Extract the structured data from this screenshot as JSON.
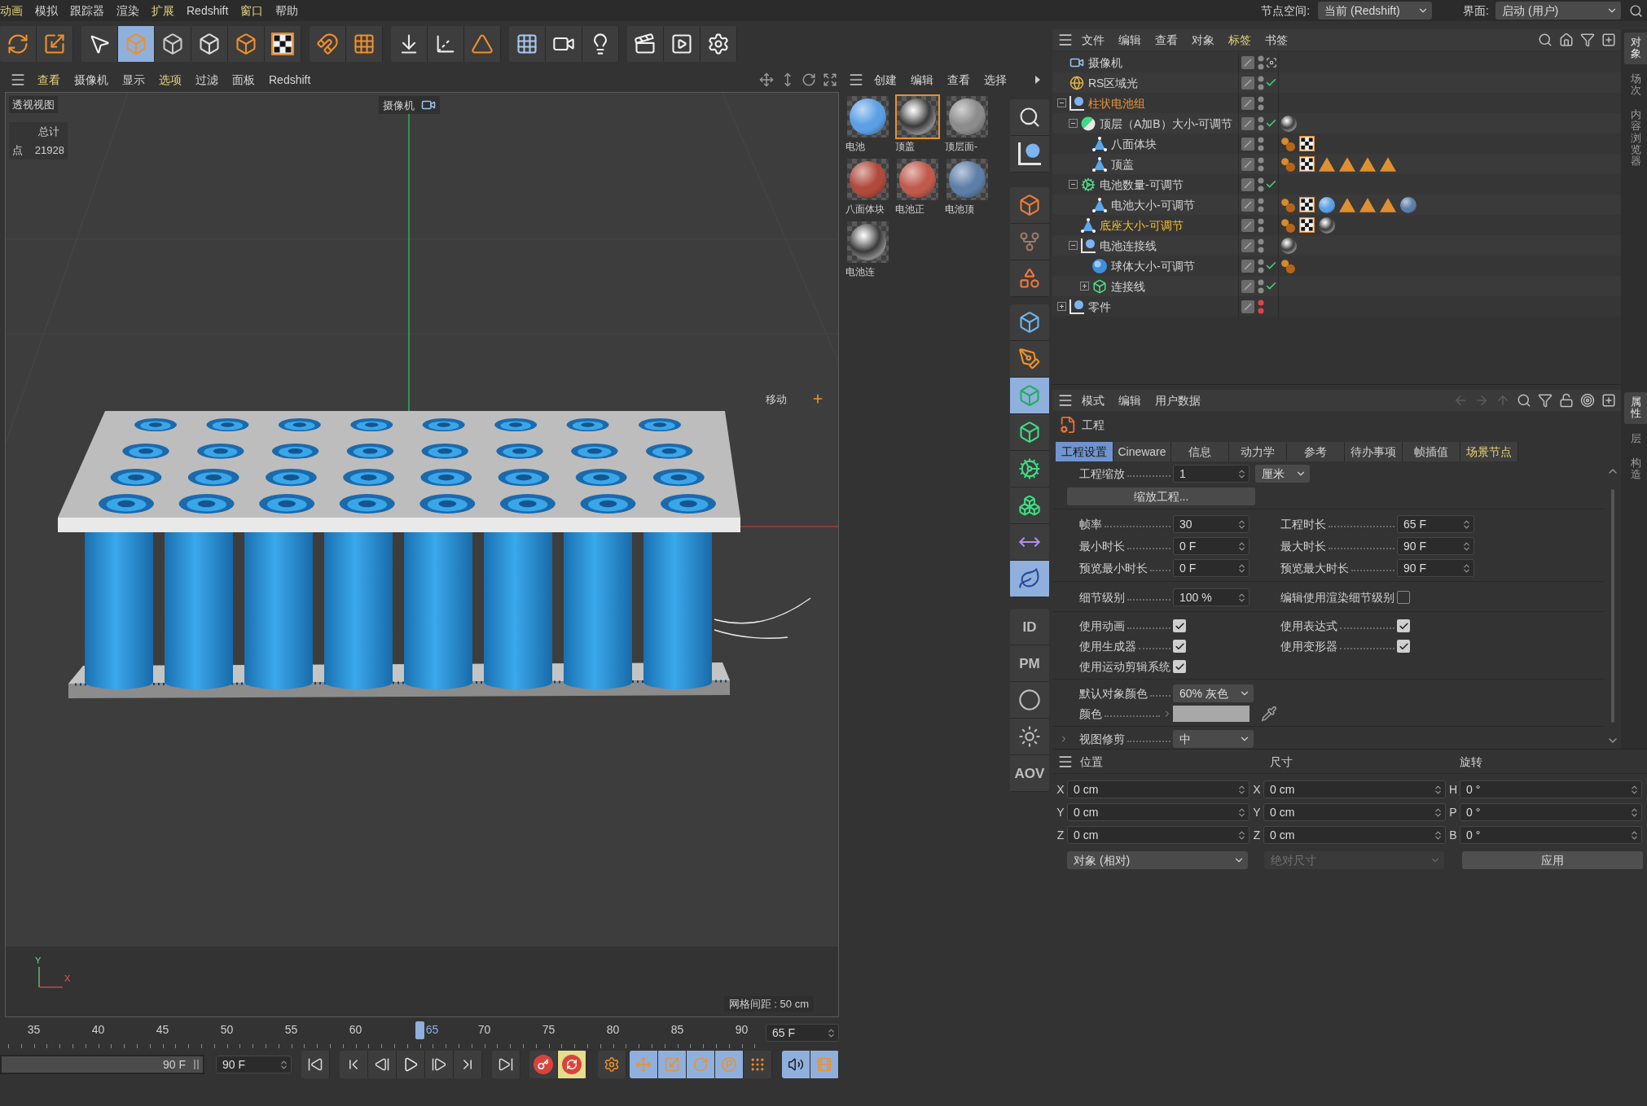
{
  "menu_bar": {
    "items": [
      {
        "label": "动画",
        "accent": true
      },
      {
        "label": "模拟",
        "accent": false
      },
      {
        "label": "跟踪器",
        "accent": false
      },
      {
        "label": "渲染",
        "accent": false
      },
      {
        "label": "扩展",
        "accent": true
      },
      {
        "label": "Redshift",
        "accent": false
      },
      {
        "label": "窗口",
        "accent": true
      },
      {
        "label": "帮助",
        "accent": false
      }
    ],
    "node_space": {
      "label": "节点空间:",
      "value": "当前 (Redshift)"
    },
    "interface": {
      "label": "界面:",
      "value": "启动 (用户)"
    }
  },
  "toolbar": [
    [
      {
        "kind": "undo",
        "selected": false
      },
      {
        "kind": "scale",
        "selected": false
      }
    ],
    [
      {
        "kind": "select",
        "selected": false
      },
      {
        "kind": "model",
        "selected": true
      },
      {
        "kind": "points",
        "selected": false
      },
      {
        "kind": "edges",
        "selected": false
      },
      {
        "kind": "polygons",
        "selected": false
      },
      {
        "kind": "uv",
        "selected": false
      }
    ],
    [
      {
        "kind": "magnet",
        "selected": false
      },
      {
        "kind": "grid",
        "selected": false
      }
    ],
    [
      {
        "kind": "floor-snap",
        "selected": false
      },
      {
        "kind": "axis",
        "selected": false
      },
      {
        "kind": "triangle",
        "selected": false
      }
    ],
    [
      {
        "kind": "floor",
        "selected": false
      },
      {
        "kind": "camera",
        "selected": false
      },
      {
        "kind": "light",
        "selected": false
      }
    ],
    [
      {
        "kind": "render-region",
        "selected": false
      },
      {
        "kind": "render",
        "selected": false
      },
      {
        "kind": "render-settings",
        "selected": false
      }
    ]
  ],
  "viewport": {
    "menu": [
      {
        "label": "查看",
        "accent": true
      },
      {
        "label": "摄像机",
        "accent": false
      },
      {
        "label": "显示",
        "accent": false
      },
      {
        "label": "选项",
        "accent": true
      },
      {
        "label": "过滤",
        "accent": false
      },
      {
        "label": "面板",
        "accent": false
      },
      {
        "label": "Redshift",
        "accent": false
      }
    ],
    "title": "透视视图",
    "camera": "摄像机",
    "hud": {
      "header": "总计",
      "rows": [
        {
          "label": "点",
          "value": "21928"
        }
      ]
    },
    "tool": "移动",
    "grid_spacing": "网格间距 : 50 cm",
    "axes": {
      "y": "Y",
      "x": "X"
    }
  },
  "timeline": {
    "ticks": [
      {
        "label": "35",
        "current": false
      },
      {
        "label": "40",
        "current": false
      },
      {
        "label": "45",
        "current": false
      },
      {
        "label": "50",
        "current": false
      },
      {
        "label": "55",
        "current": false
      },
      {
        "label": "60",
        "current": false
      },
      {
        "label": "65",
        "current": true
      },
      {
        "label": "70",
        "current": false
      },
      {
        "label": "75",
        "current": false
      },
      {
        "label": "80",
        "current": false
      },
      {
        "label": "85",
        "current": false
      },
      {
        "label": "90",
        "current": false
      }
    ],
    "current_frame": "65 F"
  },
  "transport": {
    "range": {
      "end": "90 F",
      "level": 1
    },
    "max_frame": "90 F",
    "groups": [
      [
        {
          "kind": "start",
          "selected": false
        }
      ],
      [
        {
          "kind": "prev-key",
          "selected": false
        },
        {
          "kind": "prev-frame",
          "selected": false
        },
        {
          "kind": "play",
          "selected": false
        },
        {
          "kind": "next-frame",
          "selected": false
        },
        {
          "kind": "next-key",
          "selected": false
        }
      ],
      [
        {
          "kind": "end",
          "selected": false
        }
      ],
      [
        {
          "kind": "record",
          "selected": false
        },
        {
          "kind": "autokey",
          "selected": true
        }
      ],
      [
        {
          "kind": "key-settings",
          "selected": false
        }
      ],
      [
        {
          "kind": "move-keys",
          "selected": true
        },
        {
          "kind": "scale-keys",
          "selected": true
        },
        {
          "kind": "rotate-keys",
          "selected": true
        },
        {
          "kind": "param-keys",
          "selected": true
        },
        {
          "kind": "point-keys",
          "selected": false
        }
      ],
      [
        {
          "kind": "sound",
          "selected": true
        },
        {
          "kind": "film",
          "selected": true
        }
      ]
    ]
  },
  "materials": {
    "menu": [
      "创建",
      "编辑",
      "查看",
      "选择"
    ],
    "items": [
      {
        "name": "电池",
        "kind": "matte",
        "color": "#5b9fe4",
        "selected": false
      },
      {
        "name": "顶盖",
        "kind": "chrome",
        "selected": true
      },
      {
        "name": "顶层面-",
        "kind": "matte",
        "color": "#8c8c8c",
        "selected": false
      },
      {
        "name": "八面体块",
        "kind": "matte",
        "color": "#b04a3c",
        "selected": false
      },
      {
        "name": "电池正",
        "kind": "matte",
        "color": "#bf5a4c",
        "selected": false
      },
      {
        "name": "电池顶",
        "kind": "matte",
        "color": "#5d7ea6",
        "selected": false
      },
      {
        "name": "电池连",
        "kind": "chrome",
        "selected": false
      }
    ]
  },
  "palette": [
    [
      {
        "kind": "search",
        "selected": false
      },
      {
        "kind": "null",
        "selected": false
      }
    ],
    [
      {
        "kind": "object-arrow",
        "selected": false
      },
      {
        "kind": "joint",
        "selected": false
      },
      {
        "kind": "triangles",
        "selected": false
      }
    ],
    [
      {
        "kind": "cube",
        "selected": false
      },
      {
        "kind": "pen",
        "selected": false
      },
      {
        "kind": "subdivision",
        "selected": true
      },
      {
        "kind": "extrude",
        "selected": false
      },
      {
        "kind": "cloner",
        "selected": false
      },
      {
        "kind": "cubes",
        "selected": false
      },
      {
        "kind": "measure",
        "selected": false
      },
      {
        "kind": "deformer",
        "selected": true
      }
    ],
    [
      {
        "kind": "text",
        "label": "ID",
        "selected": false
      },
      {
        "kind": "text",
        "label": "PM",
        "selected": false
      },
      {
        "kind": "ring",
        "selected": false
      },
      {
        "kind": "sun",
        "selected": false
      },
      {
        "kind": "text",
        "label": "AOV",
        "selected": false
      }
    ]
  ],
  "object_manager": {
    "menu": [
      {
        "label": "文件",
        "accent": false
      },
      {
        "label": "编辑",
        "accent": false
      },
      {
        "label": "查看",
        "accent": false
      },
      {
        "label": "对象",
        "accent": false
      },
      {
        "label": "标签",
        "accent": true
      },
      {
        "label": "书签",
        "accent": false
      }
    ],
    "objects": [
      {
        "name": "摄像机",
        "kind": "camera",
        "color": "#d4d4d4",
        "hidden": false,
        "enabled": true
      },
      {
        "name": "RS区域光",
        "kind": "light",
        "color": "#d4d4d4",
        "hidden": false,
        "enabled": true
      },
      {
        "name": "柱状电池组",
        "kind": "null",
        "color": "#e8943a",
        "hidden": false,
        "enabled": false,
        "expanded": true,
        "children": [
          {
            "name": "顶层（A加B）大小-可调节",
            "kind": "boole",
            "color": "#d4d4d4",
            "hidden": false,
            "enabled": true,
            "expanded": true,
            "tags": [
              {
                "kind": "chrome"
              }
            ],
            "children": [
              {
                "name": "八面体块",
                "kind": "polygon",
                "color": "#d4d4d4",
                "hidden": false,
                "enabled": false,
                "tags": [
                  {
                    "kind": "dots"
                  },
                  {
                    "kind": "checker"
                  }
                ]
              },
              {
                "name": "顶盖",
                "kind": "polygon",
                "color": "#d4d4d4",
                "hidden": false,
                "enabled": false,
                "tags": [
                  {
                    "kind": "dots"
                  },
                  {
                    "kind": "checker"
                  },
                  {
                    "kind": "triangle"
                  },
                  {
                    "kind": "triangle"
                  },
                  {
                    "kind": "triangle"
                  },
                  {
                    "kind": "triangle"
                  }
                ]
              }
            ]
          },
          {
            "name": "电池数量-可调节",
            "kind": "cloner",
            "color": "#d4d4d4",
            "hidden": false,
            "enabled": true,
            "expanded": true,
            "children": [
              {
                "name": "电池大小-可调节",
                "kind": "polygon",
                "color": "#d4d4d4",
                "hidden": false,
                "enabled": false,
                "tags": [
                  {
                    "kind": "dots"
                  },
                  {
                    "kind": "checker"
                  },
                  {
                    "kind": "material",
                    "color": "#5b9fe4"
                  },
                  {
                    "kind": "triangle"
                  },
                  {
                    "kind": "triangle"
                  },
                  {
                    "kind": "triangle"
                  },
                  {
                    "kind": "material",
                    "color": "#5d7ea6"
                  }
                ]
              }
            ]
          },
          {
            "name": "底座大小-可调节",
            "kind": "polygon",
            "color": "#f5c030",
            "hidden": false,
            "enabled": false,
            "tags": [
              {
                "kind": "dots"
              },
              {
                "kind": "checker"
              },
              {
                "kind": "chrome"
              }
            ]
          },
          {
            "name": "电池连接线",
            "kind": "null",
            "color": "#d4d4d4",
            "hidden": false,
            "enabled": false,
            "expanded": true,
            "tags": [
              {
                "kind": "chrome"
              }
            ],
            "children": [
              {
                "name": "球体大小-可调节",
                "kind": "sphere",
                "color": "#d4d4d4",
                "hidden": false,
                "enabled": true,
                "tags": [
                  {
                    "kind": "dots"
                  }
                ]
              },
              {
                "name": "连接线",
                "kind": "connect",
                "color": "#d4d4d4",
                "hidden": false,
                "enabled": true,
                "expanded": false
              }
            ]
          }
        ]
      },
      {
        "name": "零件",
        "kind": "null",
        "color": "#d4d4d4",
        "hidden": true,
        "enabled": false,
        "expanded": false
      }
    ]
  },
  "attributes": {
    "menu": [
      "模式",
      "编辑",
      "用户数据"
    ],
    "title": "工程",
    "tabs": [
      {
        "label": "工程设置",
        "selected": true,
        "highlighted": false
      },
      {
        "label": "Cineware",
        "selected": false,
        "highlighted": false
      },
      {
        "label": "信息",
        "selected": false,
        "highlighted": false
      },
      {
        "label": "动力学",
        "selected": false,
        "highlighted": false
      },
      {
        "label": "参考",
        "selected": false,
        "highlighted": false
      },
      {
        "label": "待办事项",
        "selected": false,
        "highlighted": false
      },
      {
        "label": "帧插值",
        "selected": false,
        "highlighted": false
      },
      {
        "label": "场景节点",
        "selected": false,
        "highlighted": true
      }
    ],
    "scale": {
      "label": "工程缩放",
      "value": "1",
      "unit": "厘米"
    },
    "scale_button": "缩放工程...",
    "timing": [
      [
        {
          "label": "帧率",
          "value": "30"
        },
        {
          "label": "工程时长",
          "value": "65 F"
        }
      ],
      [
        {
          "label": "最小时长",
          "value": "0 F"
        },
        {
          "label": "最大时长",
          "value": "90 F"
        }
      ],
      [
        {
          "label": "预览最小时长",
          "value": "0 F"
        },
        {
          "label": "预览最大时长",
          "value": "90 F"
        }
      ]
    ],
    "detail": {
      "label": "细节级别",
      "value": "100 %"
    },
    "render_detail": {
      "label": "编辑使用渲染细节级别",
      "checked": false
    },
    "options": [
      [
        {
          "label": "使用动画",
          "checked": true
        },
        {
          "label": "使用表达式",
          "checked": true
        }
      ],
      [
        {
          "label": "使用生成器",
          "checked": true
        },
        {
          "label": "使用变形器",
          "checked": true
        }
      ],
      [
        {
          "label": "使用运动剪辑系统",
          "checked": true
        }
      ]
    ],
    "default_color": {
      "label": "默认对象颜色",
      "value": "60% 灰色"
    },
    "color": {
      "label": "颜色",
      "color": "#a8a8a8"
    },
    "view_clipping": {
      "label": "视图修剪",
      "value": "中"
    }
  },
  "coordinates": {
    "headers": [
      "位置",
      "尺寸",
      "旋转"
    ],
    "rows": [
      [
        {
          "axis": "X",
          "value": "0 cm"
        },
        {
          "axis": "X",
          "value": "0 cm"
        },
        {
          "axis": "H",
          "value": "0 °"
        }
      ],
      [
        {
          "axis": "Y",
          "value": "0 cm"
        },
        {
          "axis": "Y",
          "value": "0 cm"
        },
        {
          "axis": "P",
          "value": "0 °"
        }
      ],
      [
        {
          "axis": "Z",
          "value": "0 cm"
        },
        {
          "axis": "Z",
          "value": "0 cm"
        },
        {
          "axis": "B",
          "value": "0 °"
        }
      ]
    ],
    "mode": "对象 (相对)",
    "size_mode": {
      "value": "绝对尺寸",
      "disabled": true
    },
    "apply": "应用"
  },
  "side_tabs": {
    "top": [
      {
        "label": "对象",
        "selected": true
      },
      {
        "label": "场次",
        "selected": false
      },
      {
        "label": "内容浏览器",
        "selected": false
      }
    ],
    "bottom": [
      {
        "label": "属性",
        "selected": true
      },
      {
        "label": "层",
        "selected": false
      },
      {
        "label": "构造",
        "selected": false
      }
    ]
  }
}
